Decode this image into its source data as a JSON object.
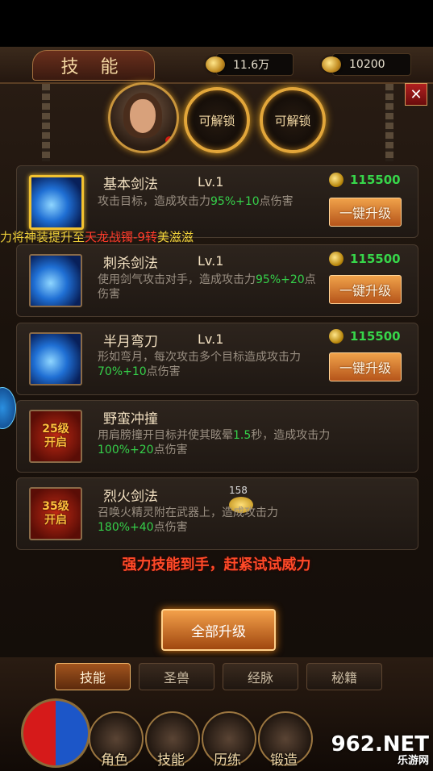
{
  "header": {
    "title": "技 能",
    "coin_amount": "11.6万",
    "gold_amount": "10200",
    "close_label": "✕"
  },
  "slots": {
    "unlock_1": "可解锁",
    "unlock_2": "可解锁"
  },
  "ticker": {
    "text_pre": "力将神装提升至",
    "text_highlight": "天龙战镯-9转",
    "text_post": "美滋滋"
  },
  "skills": [
    {
      "name": "基本剑法",
      "level": "Lv.1",
      "desc_a": "攻击目标，造成攻击力",
      "desc_b": "95%+10",
      "desc_c": "点伤害",
      "cost": "115500",
      "button": "一键升级"
    },
    {
      "name": "刺杀剑法",
      "level": "Lv.1",
      "desc_a": "使用剑气攻击对手，造成攻击力",
      "desc_b": "95%+20",
      "desc_c": "点伤害",
      "cost": "115500",
      "button": "一键升级"
    },
    {
      "name": "半月弯刀",
      "level": "Lv.1",
      "desc_a": "形如弯月，每次攻击多个目标造成攻击力",
      "desc_b": "70%+10",
      "desc_c": "点伤害",
      "cost": "115500",
      "button": "一键升级"
    },
    {
      "name": "野蛮冲撞",
      "lock_line1": "25级",
      "lock_line2": "开启",
      "desc_a": "用肩膀撞开目标并使其眩晕",
      "desc_b": "1.5",
      "desc_c": "秒，造成攻击力",
      "desc_d": "100%+20",
      "desc_e": "点伤害"
    },
    {
      "name": "烈火剑法",
      "lock_line1": "35级",
      "lock_line2": "开启",
      "desc_a": "召唤火精灵附在武器上，造成攻击力",
      "desc_b": "180%+40",
      "desc_c": "点伤害",
      "drop_count": "158"
    }
  ],
  "promo": "强力技能到手，赶紧试试威力",
  "upgrade_all": "全部升级",
  "tabs": [
    "技能",
    "圣兽",
    "经脉",
    "秘籍"
  ],
  "nav": [
    "角色",
    "技能",
    "历练",
    "锻造"
  ],
  "watermark": {
    "site": "962.NET",
    "sub": "乐游网"
  },
  "colors": {
    "highlight_green": "#35d04a",
    "promo_red": "#ff4a28",
    "ticker_yellow": "#f0d13a"
  }
}
